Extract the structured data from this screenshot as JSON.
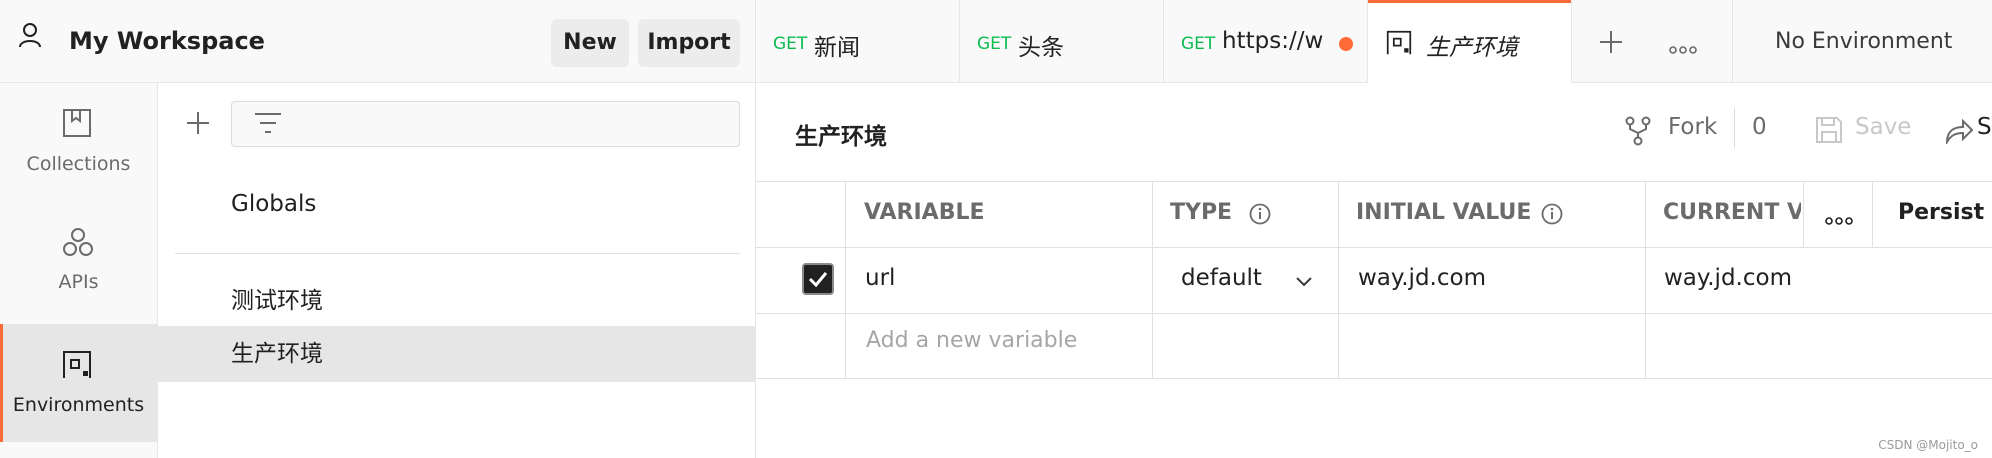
{
  "workspace": {
    "title": "My Workspace",
    "new_label": "New",
    "import_label": "Import"
  },
  "sidebar": {
    "items": [
      {
        "label": "Collections",
        "icon": "collections-icon",
        "active": false
      },
      {
        "label": "APIs",
        "icon": "apis-icon",
        "active": false
      },
      {
        "label": "Environments",
        "icon": "environments-icon",
        "active": true
      }
    ]
  },
  "env_list": {
    "items": [
      {
        "label": "Globals"
      },
      {
        "label": "测试环境"
      },
      {
        "label": "生产环境",
        "selected": true
      }
    ]
  },
  "tabs": [
    {
      "method": "GET",
      "name": "新闻"
    },
    {
      "method": "GET",
      "name": "头条"
    },
    {
      "method": "GET",
      "name": "https://w",
      "unsaved": true
    },
    {
      "method": "",
      "name": "生产环境",
      "active": true
    }
  ],
  "environment_selector": "No Environment",
  "main": {
    "title": "生产环境",
    "fork_label": "Fork",
    "fork_count": "0",
    "save_label": "Save",
    "share_label": "S"
  },
  "table": {
    "headers": {
      "variable": "VARIABLE",
      "type": "TYPE",
      "initial_value": "INITIAL VALUE",
      "current_value": "CURRENT VA",
      "persist": "Persist A"
    },
    "rows": [
      {
        "checked": true,
        "variable": "url",
        "type": "default",
        "initial_value": "way.jd.com",
        "current_value": "way.jd.com"
      }
    ],
    "add_placeholder": "Add a new variable"
  },
  "watermark": "CSDN @Mojito_o",
  "colors": {
    "accent": "#ff6c37",
    "method_get": "#0cbb52",
    "selected_bg": "#e6e6e6"
  }
}
